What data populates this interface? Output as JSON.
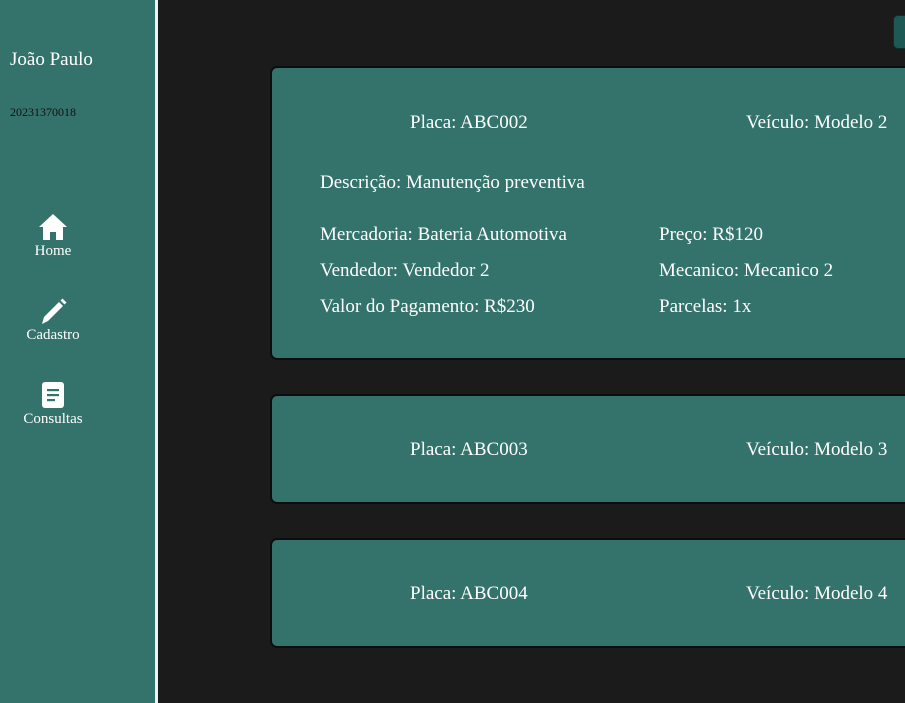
{
  "sidebar": {
    "user_name": "João Paulo",
    "user_id": "20231370018",
    "nav": [
      {
        "label": "Home",
        "icon": "home-icon"
      },
      {
        "label": "Cadastro",
        "icon": "pencil-icon"
      },
      {
        "label": "Consultas",
        "icon": "document-icon"
      }
    ]
  },
  "cards": [
    {
      "placa": "Placa: ABC002",
      "veiculo": "Veículo: Modelo 2",
      "descricao": "Descrição: Manutenção preventiva",
      "mercadoria": "Mercadoria: Bateria Automotiva",
      "preco": "Preço: R$120",
      "vendedor": "Vendedor: Vendedor 2",
      "mecanico": "Mecanico: Mecanico 2",
      "valor_pagamento": "Valor do Pagamento: R$230",
      "parcelas": "Parcelas: 1x"
    },
    {
      "placa": "Placa: ABC003",
      "veiculo": "Veículo: Modelo 3"
    },
    {
      "placa": "Placa: ABC004",
      "veiculo": "Veículo: Modelo 4"
    }
  ],
  "colors": {
    "background": "#1b1b1b",
    "sidebar": "#34736b",
    "card": "#34736b",
    "text": "#ffffff"
  }
}
